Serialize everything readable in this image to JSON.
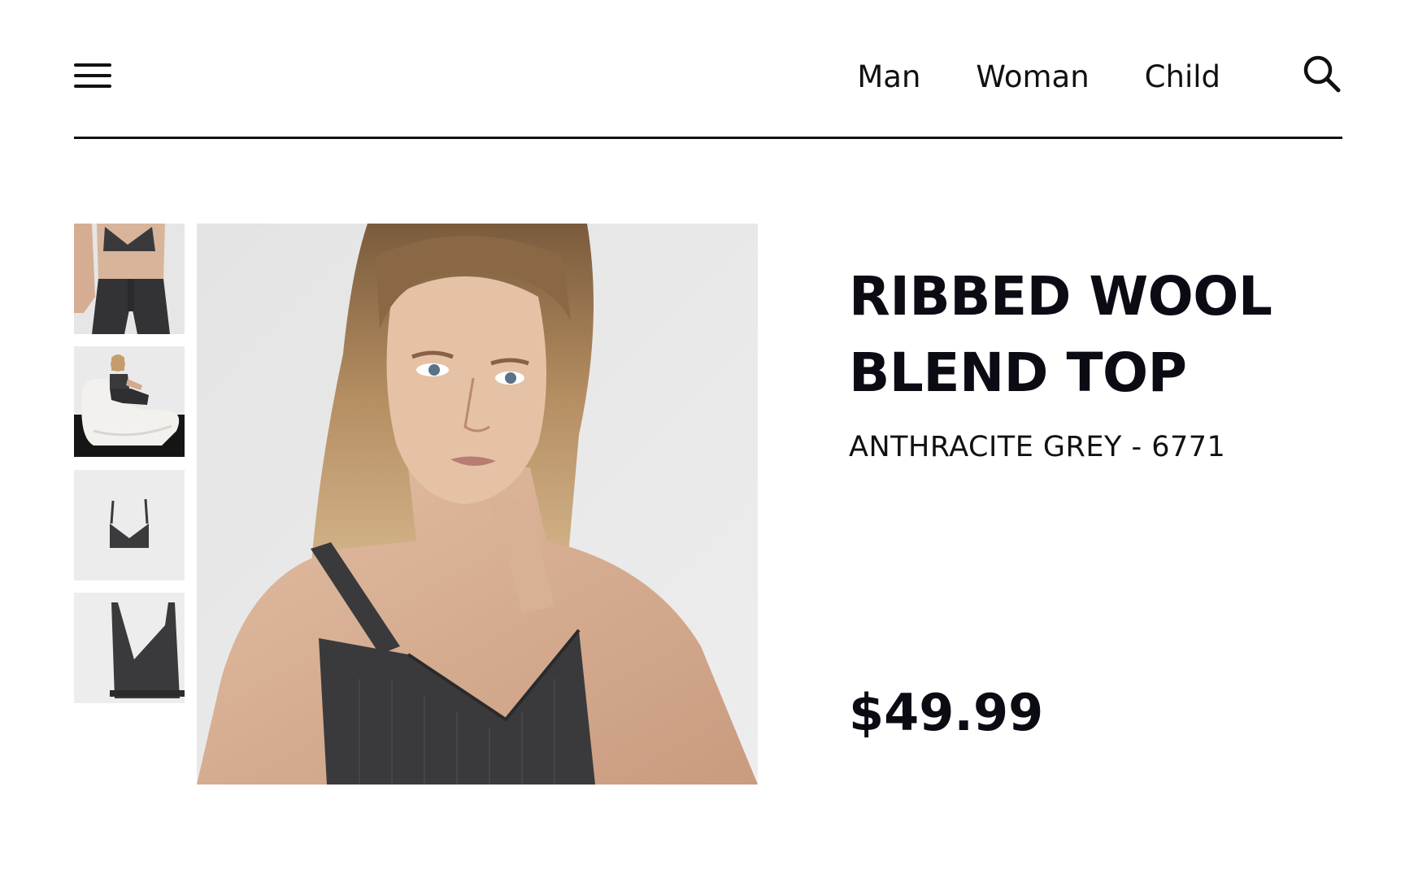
{
  "header": {
    "nav": [
      "Man",
      "Woman",
      "Child"
    ]
  },
  "icons": {
    "menu": "hamburger-menu-icon",
    "search": "search-icon"
  },
  "gallery": {
    "thumbnails": [
      "model wearing top and knit trousers, cropped",
      "model seated on white lounge chair",
      "top laid flat",
      "top close-up"
    ],
    "main_image": "model wearing the ribbed top"
  },
  "product": {
    "title": "RIBBED WOOL BLEND TOP",
    "color_ref": "ANTHRACITE GREY - 6771",
    "price": "$49.99"
  },
  "colors": {
    "accent": "#111111",
    "knit": "#3a3a3c",
    "backdrop": "#e9e9e9"
  }
}
